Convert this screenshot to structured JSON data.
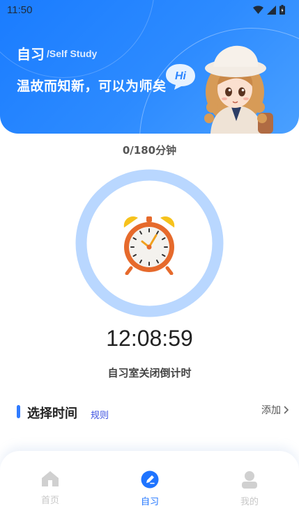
{
  "status": {
    "time": "11:50"
  },
  "header": {
    "title": "自习",
    "subtitle": "/Self Study",
    "slogan": "温故而知新，可以为师矣",
    "bubble": "Hi"
  },
  "study": {
    "minutes": "0/180分钟",
    "progress_fraction": 0,
    "countdown": "12:08:59",
    "countdown_label": "自习室关闭倒计时"
  },
  "section": {
    "title": "选择时间",
    "rules": "规则",
    "add": "添加"
  },
  "tabs": [
    {
      "label": "首页",
      "icon": "home-icon",
      "active": false
    },
    {
      "label": "自习",
      "icon": "pen-icon",
      "active": true
    },
    {
      "label": "我的",
      "icon": "user-icon",
      "active": false
    }
  ],
  "colors": {
    "accent": "#1f74ff",
    "ring": "#b9d7ff",
    "header": "#2d8bff"
  }
}
